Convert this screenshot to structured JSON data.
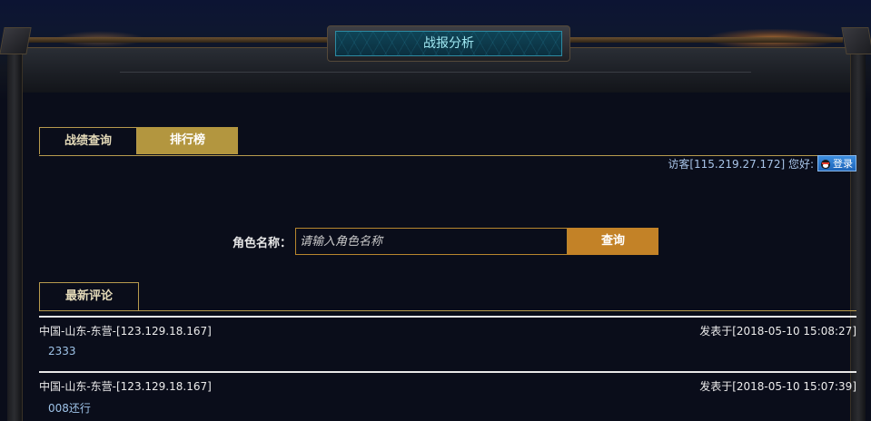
{
  "panel": {
    "title": "战报分析"
  },
  "tabs": [
    {
      "label": "战绩查询",
      "active": false
    },
    {
      "label": "排行榜",
      "active": true
    }
  ],
  "visitor": {
    "text": "访客[115.219.27.172] 您好:",
    "login_label": "登录",
    "login_icon": "qq-penguin-icon"
  },
  "search": {
    "label": "角色名称：",
    "placeholder": "请输入角色名称",
    "value": "",
    "button_label": "查询"
  },
  "comments": {
    "header_label": "最新评论",
    "items": [
      {
        "author": "中国-山东-东营-[123.129.18.167]",
        "time": "发表于[2018-05-10 15:08:27]",
        "body": "2333"
      },
      {
        "author": "中国-山东-东营-[123.129.18.167]",
        "time": "发表于[2018-05-10 15:07:39]",
        "body": "008还行"
      }
    ]
  },
  "colors": {
    "accent_gold": "#b3963f",
    "button_orange": "#c38227",
    "title_teal": "#9fe6f0",
    "background": "#0a0d1a"
  }
}
